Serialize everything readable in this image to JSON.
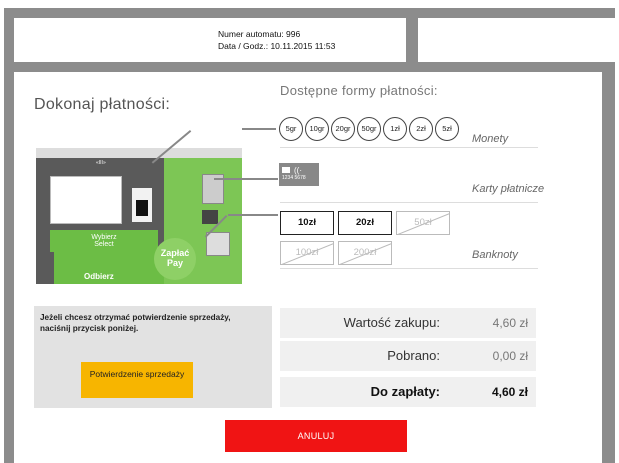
{
  "header": {
    "machine_number": "Numer automatu: 996",
    "datetime": "Data / Godz.: 10.11.2015 11:53"
  },
  "title": "Dokonaj płatności:",
  "payment_forms_title": "Dostępne formy płatności:",
  "coins": {
    "label": "Monety",
    "items": [
      "5gr",
      "10gr",
      "20gr",
      "50gr",
      "1zł",
      "2zł",
      "5zł"
    ]
  },
  "cards": {
    "label": "Karty płatnicze",
    "card_digits": "1234 5678"
  },
  "banknotes": {
    "label": "Banknoty",
    "row1": [
      {
        "value": "10zł",
        "enabled": true
      },
      {
        "value": "20zł",
        "enabled": true
      },
      {
        "value": "50zł",
        "enabled": false
      }
    ],
    "row2": [
      {
        "value": "100zł",
        "enabled": false
      },
      {
        "value": "200zł",
        "enabled": false
      }
    ]
  },
  "machine_picture": {
    "top_label": "«III»",
    "select_label": "Wybierz\nSelect",
    "pay_label": "Zapłać\nPay",
    "collect_label": "Odbierz"
  },
  "receipt": {
    "info": "Jeżeli chcesz otrzymać potwierdzenie sprzedaży, naciśnij przycisk poniżej.",
    "button": "Potwierdzenie sprzedaży"
  },
  "summary": {
    "purchase_value_label": "Wartość zakupu:",
    "purchase_value": "4,60 zł",
    "collected_label": "Pobrano:",
    "collected": "0,00 zł",
    "due_label": "Do zapłaty:",
    "due": "4,60 zł"
  },
  "cancel_button": "ANULUJ",
  "colors": {
    "frame": "#8c8c8c",
    "confirm": "#f7b500",
    "cancel": "#f01414",
    "machine_green": "#6cbd45"
  }
}
